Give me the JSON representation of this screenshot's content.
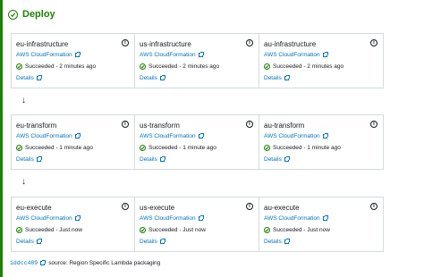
{
  "header": {
    "title": "Deploy"
  },
  "rows": [
    [
      {
        "name": "eu-infrastructure",
        "provider": "AWS CloudFormation",
        "status": "Succeeded - 2 minutes ago",
        "details": "Details"
      },
      {
        "name": "us-infrastructure",
        "provider": "AWS CloudFormation",
        "status": "Succeeded - 2 minutes ago",
        "details": "Details"
      },
      {
        "name": "au-infrastructure",
        "provider": "AWS CloudFormation",
        "status": "Succeeded - 2 minutes ago",
        "details": "Details"
      }
    ],
    [
      {
        "name": "eu-transform",
        "provider": "AWS CloudFormation",
        "status": "Succeeded - 1 minute ago",
        "details": "Details"
      },
      {
        "name": "us-transform",
        "provider": "AWS CloudFormation",
        "status": "Succeeded - 1 minute ago",
        "details": "Details"
      },
      {
        "name": "au-transform",
        "provider": "AWS CloudFormation",
        "status": "Succeeded - 1 minute ago",
        "details": "Details"
      }
    ],
    [
      {
        "name": "eu-execute",
        "provider": "AWS CloudFormation",
        "status": "Succeeded - Just now",
        "details": "Details"
      },
      {
        "name": "us-execute",
        "provider": "AWS CloudFormation",
        "status": "Succeeded - Just now",
        "details": "Details"
      },
      {
        "name": "au-execute",
        "provider": "AWS CloudFormation",
        "status": "Succeeded - Just now",
        "details": "Details"
      }
    ]
  ],
  "footer": {
    "commit": "1ddcc489",
    "source": "source: Region Specific Lambda packaging"
  },
  "colors": {
    "success": "#1d8102",
    "link": "#0073bb",
    "border": "#d5dbdb"
  }
}
